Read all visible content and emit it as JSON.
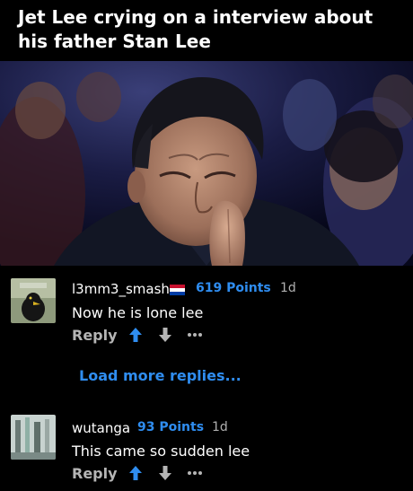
{
  "post": {
    "title": "Jet Lee crying on a interview about his father Stan Lee"
  },
  "comments": [
    {
      "username": "l3mm3_smash",
      "points": "619 Points",
      "time": "1d",
      "text": "Now he is lone lee",
      "reply_label": "Reply",
      "flag_icon": "netherlands-flag-icon"
    },
    {
      "username": "wutanga",
      "points": "93 Points",
      "time": "1d",
      "text": "This came so sudden lee",
      "reply_label": "Reply"
    }
  ],
  "load_more_label": "Load more replies...",
  "colors": {
    "accent": "#2f8df0",
    "background": "#000000",
    "muted": "#b5b5b5"
  }
}
